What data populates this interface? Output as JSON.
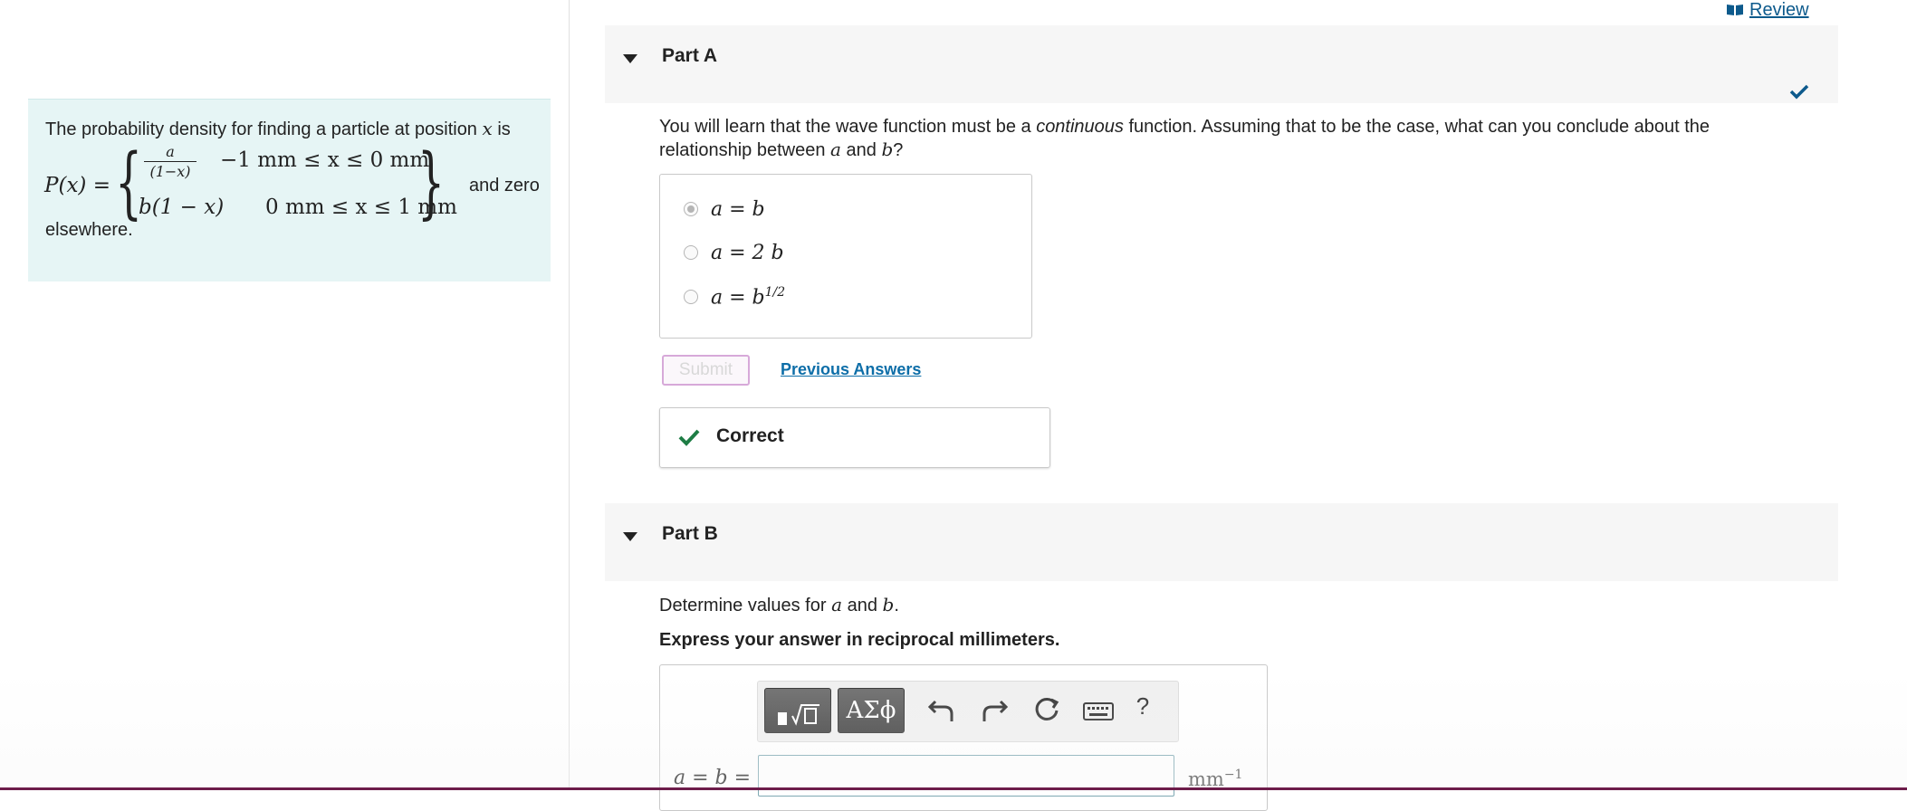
{
  "problem": {
    "intro_text": "The probability density for finding a particle at position",
    "intro_var": "x",
    "intro_is": "is",
    "lhs": "P(x) =",
    "row1_numerator": "a",
    "row1_denominator": "(1−x)",
    "row1_condition": "−1 mm ≤ x ≤ 0 mm",
    "row2_function": "b(1 − x)",
    "row2_condition": "0 mm ≤ x ≤ 1 mm",
    "tail_text": "and zero",
    "outro_text": "elsewhere."
  },
  "header": {
    "review_label": "Review"
  },
  "part_a": {
    "title": "Part A",
    "status": "correct",
    "question_pre": "You will learn that the wave function must be a",
    "question_em": "continuous",
    "question_mid": "function. Assuming that to be the case, what can you conclude about the relationship between",
    "question_var_a": "a",
    "question_and": "and",
    "question_var_b": "b",
    "question_end": "?",
    "choices": [
      {
        "label": "a = b",
        "selected": true
      },
      {
        "label": "a = 2 b",
        "selected": false
      },
      {
        "label": "a = b",
        "sup": "1/2",
        "selected": false
      }
    ],
    "submit_label": "Submit",
    "previous_answers_label": "Previous Answers",
    "feedback_label": "Correct"
  },
  "part_b": {
    "title": "Part B",
    "question_pre": "Determine values for",
    "question_var_a": "a",
    "question_and": "and",
    "question_var_b": "b",
    "question_end": ".",
    "instruction": "Express your answer in reciprocal millimeters.",
    "toolbar": {
      "symbols_label": "ΑΣϕ",
      "help_label": "?"
    },
    "answer_label": "a = b =",
    "answer_value": "",
    "unit": "mm",
    "unit_sup": "−1"
  },
  "colors": {
    "accent_teal": "#0d5a8c",
    "correct_green": "#1e7d45",
    "problem_bg": "#e6f5f5",
    "submit_border": "#d7a9d9"
  }
}
